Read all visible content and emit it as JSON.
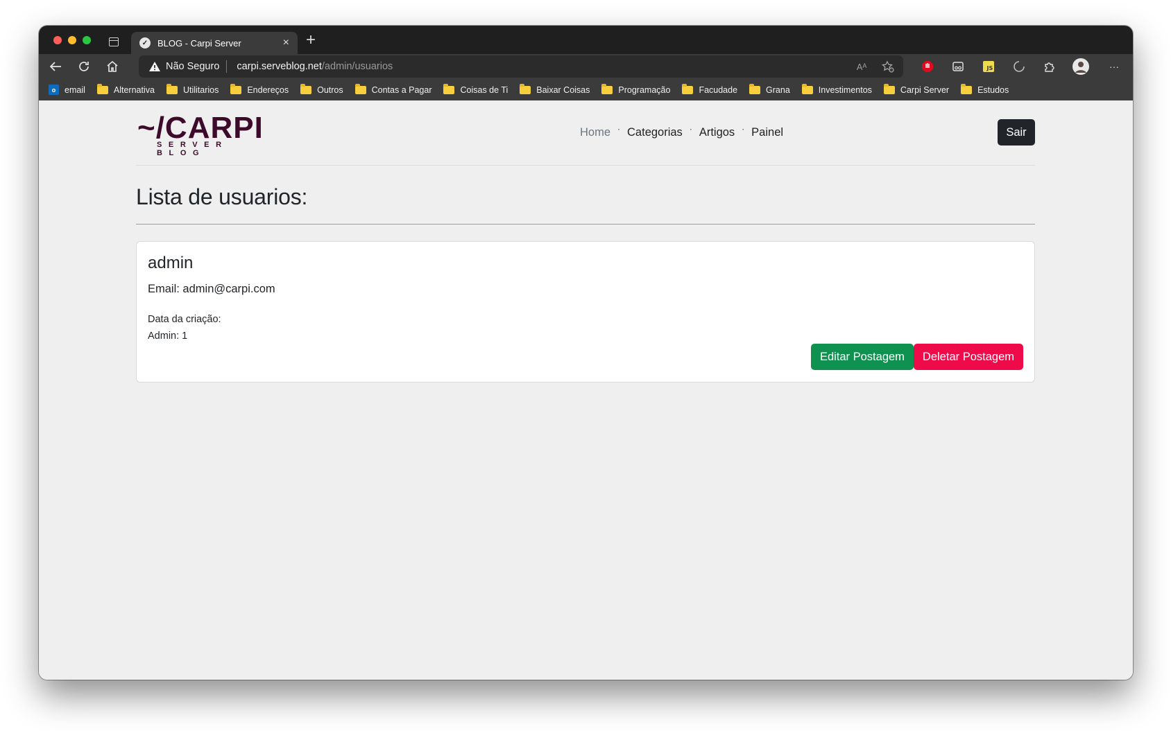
{
  "browser": {
    "tab_title": "BLOG - Carpi Server",
    "tab_close": "×",
    "new_tab": "+",
    "security_label": "Não Seguro",
    "url_host": "carpi.serveblog.net",
    "url_path": "/admin/usuarios",
    "read_aloud": "Aᴬ",
    "more": "···"
  },
  "bookmarks": [
    {
      "label": "email",
      "icon": "outlook-icon"
    },
    {
      "label": "Alternativa",
      "icon": "folder-icon"
    },
    {
      "label": "Utilitarios",
      "icon": "folder-icon"
    },
    {
      "label": "Endereços",
      "icon": "folder-icon"
    },
    {
      "label": "Outros",
      "icon": "folder-icon"
    },
    {
      "label": "Contas a Pagar",
      "icon": "folder-icon"
    },
    {
      "label": "Coisas de Ti",
      "icon": "folder-icon"
    },
    {
      "label": "Baixar Coisas",
      "icon": "folder-icon"
    },
    {
      "label": "Programação",
      "icon": "folder-icon"
    },
    {
      "label": "Facudade",
      "icon": "folder-icon"
    },
    {
      "label": "Grana",
      "icon": "folder-icon"
    },
    {
      "label": "Investimentos",
      "icon": "folder-icon"
    },
    {
      "label": "Carpi Server",
      "icon": "folder-icon"
    },
    {
      "label": "Estudos",
      "icon": "folder-icon"
    }
  ],
  "site": {
    "logo_main": "~/CARPI",
    "logo_sub": "SERVER BLOG",
    "nav": {
      "home": "Home",
      "categorias": "Categorias",
      "artigos": "Artigos",
      "painel": "Painel",
      "separator": "·"
    },
    "logout": "Sair"
  },
  "main": {
    "title": "Lista de usuarios:",
    "users": [
      {
        "name": "admin",
        "email_line": "Email: admin@carpi.com",
        "created_line": "Data da criação:",
        "admin_line": "Admin: 1",
        "edit_label": "Editar Postagem",
        "delete_label": "Deletar Postagem"
      }
    ]
  },
  "colors": {
    "brand": "#3d0a2b",
    "edit": "#0f9150",
    "delete": "#ef0a4a",
    "dark_button": "#212529"
  }
}
